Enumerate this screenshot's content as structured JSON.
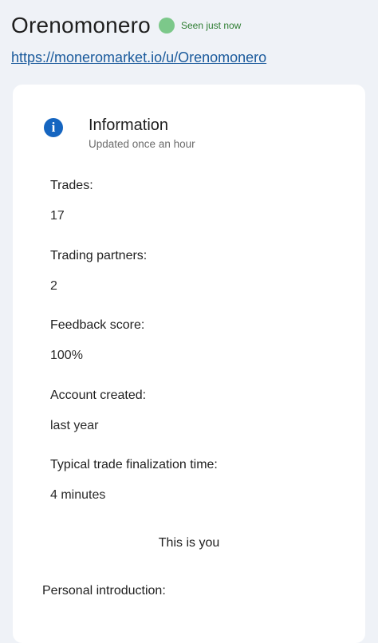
{
  "profile": {
    "username": "Orenomonero",
    "status_text": "Seen just now",
    "status_color": "#7cc88a",
    "link": "https://moneromarket.io/u/Orenomonero"
  },
  "info": {
    "icon": "info-icon",
    "title": "Information",
    "subtitle": "Updated once an hour"
  },
  "stats": [
    {
      "label": "Trades:",
      "value": "17"
    },
    {
      "label": "Trading partners:",
      "value": "2"
    },
    {
      "label": "Feedback score:",
      "value": "100%"
    },
    {
      "label": "Account created:",
      "value": "last year"
    },
    {
      "label": "Typical trade finalization time:",
      "value": "4 minutes"
    }
  ],
  "self_notice": "This is you",
  "intro_label": "Personal introduction:"
}
